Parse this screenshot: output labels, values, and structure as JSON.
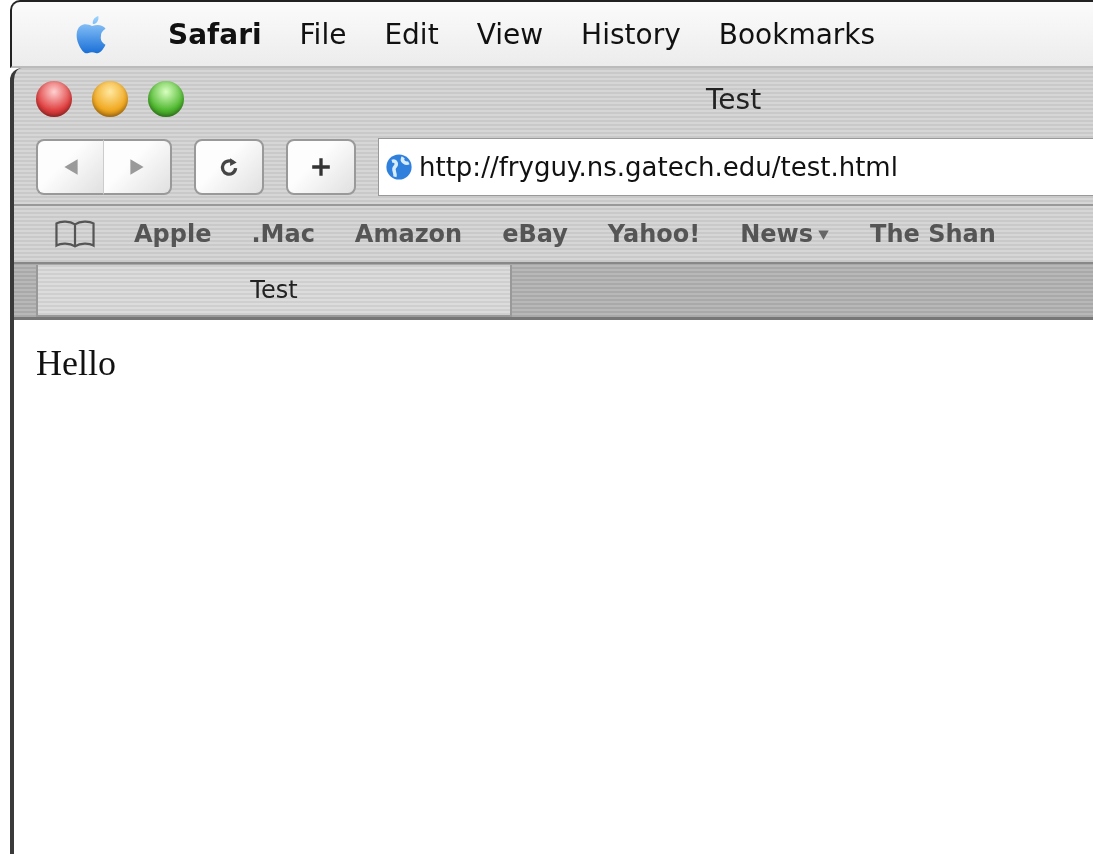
{
  "menu_bar": {
    "app_name": "Safari",
    "items": [
      "File",
      "Edit",
      "View",
      "History",
      "Bookmarks"
    ]
  },
  "window": {
    "title": "Test"
  },
  "toolbar": {
    "url": "http://fryguy.ns.gatech.edu/test.html"
  },
  "bookmarks_bar": [
    {
      "label": "Apple",
      "kind": "link"
    },
    {
      "label": ".Mac",
      "kind": "link"
    },
    {
      "label": "Amazon",
      "kind": "link"
    },
    {
      "label": "eBay",
      "kind": "link"
    },
    {
      "label": "Yahoo!",
      "kind": "link"
    },
    {
      "label": "News",
      "kind": "menu"
    },
    {
      "label": "The Shan",
      "kind": "link"
    }
  ],
  "tabs": [
    {
      "label": "Test",
      "selected": true
    }
  ],
  "page": {
    "text": "Hello"
  }
}
